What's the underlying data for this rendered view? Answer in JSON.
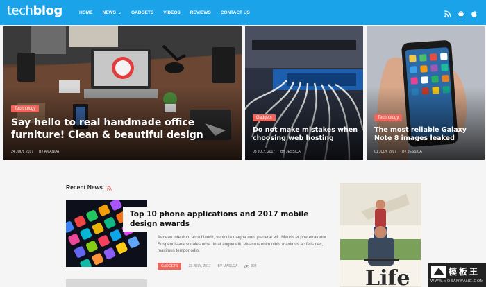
{
  "brand": {
    "logo_light": "tech",
    "logo_bold": "blog"
  },
  "nav": {
    "items": [
      "HOME",
      "NEWS",
      "GADGETS",
      "VIDEOS",
      "REVIEWS",
      "CONTACT US"
    ],
    "news_chevron": "⌄"
  },
  "social": [
    "rss-icon",
    "android-icon",
    "apple-icon"
  ],
  "hero": [
    {
      "category": "Technology",
      "title": "Say hello to real handmade office furniture! Clean & beautiful design",
      "date": "24 JULY, 2017",
      "author": "BY AMANDA"
    },
    {
      "category": "Gadgets",
      "title": "Do not make mistakes when choosing web hosting",
      "date": "03 JULY, 2017",
      "author": "BY JESSICA"
    },
    {
      "category": "Technology",
      "title": "The most reliable Galaxy Note 8 images leaked",
      "date": "01 JULY, 2017",
      "author": "BY JESSICA"
    }
  ],
  "recent": {
    "heading": "Recent News",
    "post": {
      "title": "Top 10 phone applications and 2017 mobile design awards",
      "excerpt": "Aenean interdum arcu blandit, vehicula magna non, placerat elit. Mauris et pharetratortor. Suspendissea sodales urna. In at augue elit. Vivamus enim nibh, maximus ac felis nec, maximus tempor odio.",
      "tag": "GADGETS",
      "date": "23 JULY, 2017",
      "author": "BY MASLOA",
      "views": "804"
    }
  },
  "ad": {
    "text": "Life"
  },
  "watermark": {
    "title": "模板王",
    "url": "WWW.MOBANWANG.COM"
  },
  "colors": {
    "header": "#1aa3e8",
    "accent": "#f0645a"
  }
}
